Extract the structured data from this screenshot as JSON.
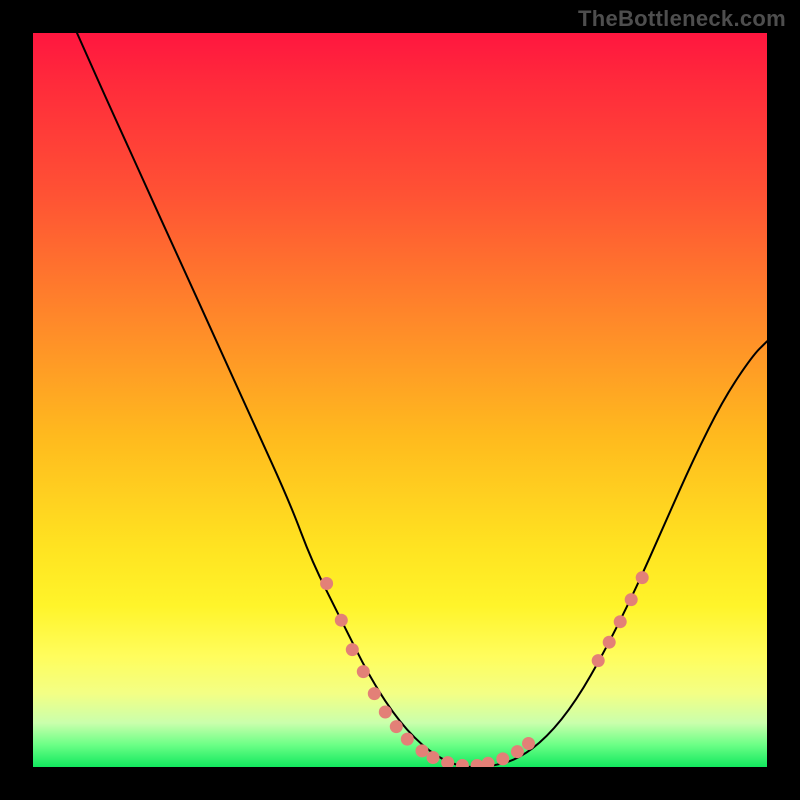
{
  "watermark": "TheBottleneck.com",
  "colors": {
    "background": "#000000",
    "curve": "#000000",
    "dot": "#e38077",
    "gradient": [
      "#ff163f",
      "#ff8b29",
      "#ffe321",
      "#12e85e"
    ]
  },
  "chart_data": {
    "type": "line",
    "title": "",
    "xlabel": "",
    "ylabel": "",
    "xlim": [
      0,
      100
    ],
    "ylim": [
      0,
      100
    ],
    "grid": false,
    "legend": false,
    "series": [
      {
        "name": "bottleneck-curve",
        "x": [
          6,
          10,
          15,
          20,
          25,
          30,
          35,
          38,
          42,
          46,
          50,
          54,
          58,
          62,
          66,
          70,
          74,
          78,
          82,
          86,
          90,
          94,
          98,
          100
        ],
        "y": [
          100,
          91,
          80,
          69,
          58,
          47,
          36,
          28,
          20,
          12,
          6,
          2,
          0,
          0,
          1,
          4,
          9,
          16,
          24,
          33,
          42,
          50,
          56,
          58
        ]
      }
    ],
    "markers": {
      "name": "highlight-dots",
      "points": [
        {
          "x": 40,
          "y": 25
        },
        {
          "x": 42,
          "y": 20
        },
        {
          "x": 43.5,
          "y": 16
        },
        {
          "x": 45,
          "y": 13
        },
        {
          "x": 46.5,
          "y": 10
        },
        {
          "x": 48,
          "y": 7.5
        },
        {
          "x": 49.5,
          "y": 5.5
        },
        {
          "x": 51,
          "y": 3.8
        },
        {
          "x": 53,
          "y": 2.2
        },
        {
          "x": 54.5,
          "y": 1.3
        },
        {
          "x": 56.5,
          "y": 0.6
        },
        {
          "x": 58.5,
          "y": 0.2
        },
        {
          "x": 60.5,
          "y": 0.2
        },
        {
          "x": 62,
          "y": 0.5
        },
        {
          "x": 64,
          "y": 1.1
        },
        {
          "x": 66,
          "y": 2.1
        },
        {
          "x": 67.5,
          "y": 3.2
        },
        {
          "x": 77,
          "y": 14.5
        },
        {
          "x": 78.5,
          "y": 17
        },
        {
          "x": 80,
          "y": 19.8
        },
        {
          "x": 81.5,
          "y": 22.8
        },
        {
          "x": 83,
          "y": 25.8
        }
      ]
    }
  }
}
